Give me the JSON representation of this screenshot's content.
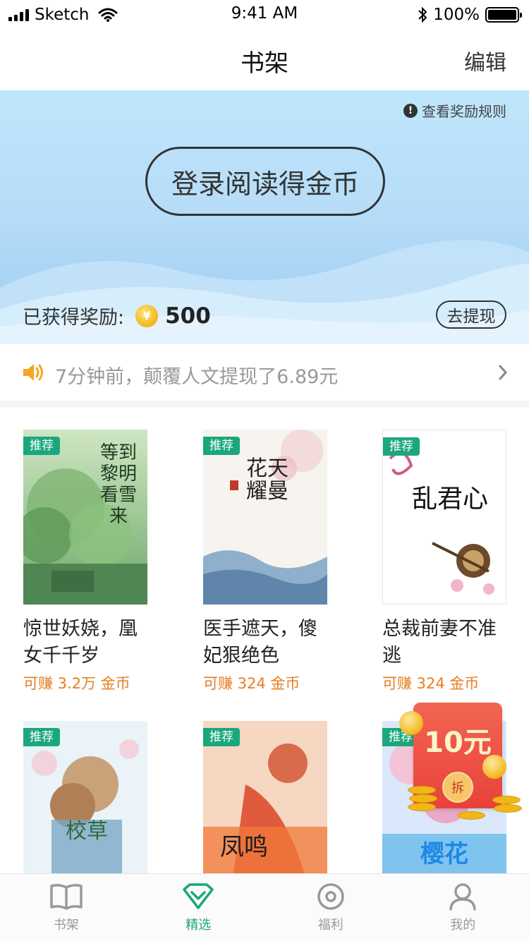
{
  "status_bar": {
    "carrier": "Sketch",
    "time": "9:41 AM",
    "battery": "100%"
  },
  "nav": {
    "title": "书架",
    "edit": "编辑"
  },
  "banner": {
    "rules_link": "查看奖励规则",
    "login_button": "登录阅读得金币",
    "reward_label": "已获得奖励:",
    "coin_symbol": "¥",
    "reward_value": "500",
    "withdraw_button": "去提现"
  },
  "notice": {
    "text": "7分钟前，颠覆人文提现了6.89元"
  },
  "books": [
    {
      "tag": "推荐",
      "title": "惊世妖娆，凰女千千岁",
      "earn": "可赚 3.2万 金币",
      "cover_text": "等到黎明看雪来"
    },
    {
      "tag": "推荐",
      "title": "医手遮天，傻妃狠绝色",
      "earn": "可赚 324 金币",
      "cover_text": "花天耀曼"
    },
    {
      "tag": "推荐",
      "title": "总裁前妻不准逃",
      "earn": "可赚 324 金币",
      "cover_text": "乱君心"
    },
    {
      "tag": "推荐",
      "title": "",
      "earn": "",
      "cover_text": "校草"
    },
    {
      "tag": "推荐",
      "title": "",
      "earn": "",
      "cover_text": "凤鸣"
    },
    {
      "tag": "推荐",
      "title": "",
      "earn": "",
      "cover_text": "樱花"
    }
  ],
  "red_packet": {
    "amount": "10元",
    "open": "拆"
  },
  "tabs": [
    {
      "label": "书架",
      "icon": "book-icon",
      "active": false
    },
    {
      "label": "精选",
      "icon": "featured-icon",
      "active": true
    },
    {
      "label": "福利",
      "icon": "welfare-icon",
      "active": false
    },
    {
      "label": "我的",
      "icon": "profile-icon",
      "active": false
    }
  ],
  "colors": {
    "accent": "#1ba77d",
    "earn": "#e67e22",
    "banner": "#b7ddf8"
  }
}
